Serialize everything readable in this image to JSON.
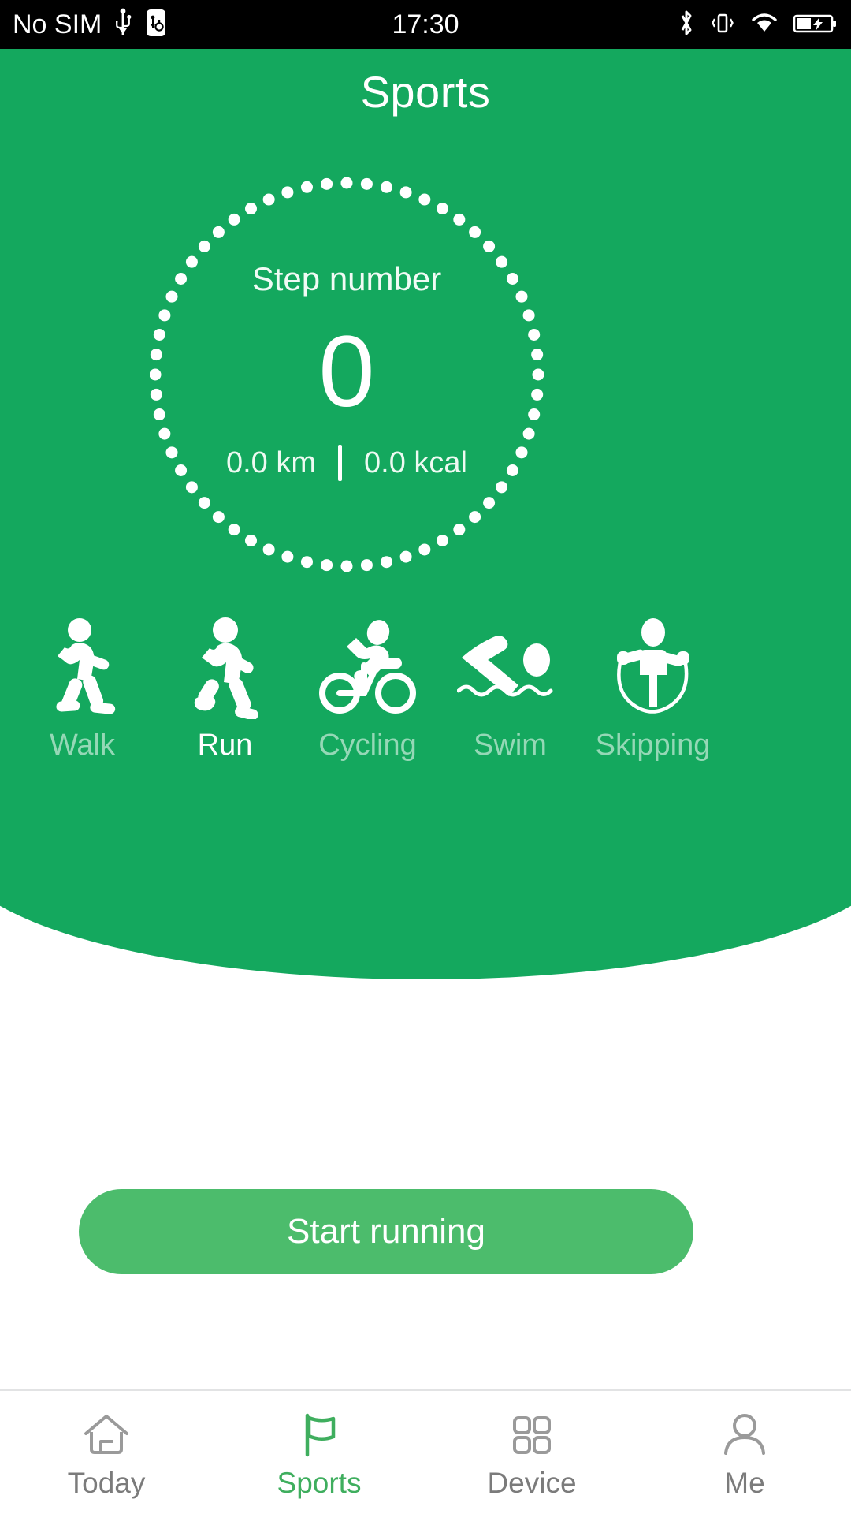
{
  "status_bar": {
    "carrier": "No SIM",
    "time": "17:30",
    "icons": [
      "usb-icon",
      "usb-debug-icon",
      "bluetooth-icon",
      "vibrate-icon",
      "wifi-icon",
      "battery-charging-icon"
    ]
  },
  "header": {
    "title": "Sports"
  },
  "step_ring": {
    "label": "Step number",
    "value": "0",
    "distance": "0.0 km",
    "calories": "0.0 kcal",
    "separator": "|",
    "dot_count": 60,
    "dot_color": "#ffffff"
  },
  "sports": {
    "selected": "Run",
    "items": [
      {
        "label": "Walk",
        "icon": "walk-icon",
        "active": false
      },
      {
        "label": "Run",
        "icon": "run-icon",
        "active": true
      },
      {
        "label": "Cycling",
        "icon": "cycling-icon",
        "active": false
      },
      {
        "label": "Swim",
        "icon": "swim-icon",
        "active": false
      },
      {
        "label": "Skipping",
        "icon": "skipping-icon",
        "active": false
      }
    ]
  },
  "action": {
    "start_label": "Start running"
  },
  "bottom_nav": {
    "items": [
      {
        "label": "Today",
        "icon": "home-icon",
        "active": false
      },
      {
        "label": "Sports",
        "icon": "flag-icon",
        "active": true
      },
      {
        "label": "Device",
        "icon": "grid-icon",
        "active": false
      },
      {
        "label": "Me",
        "icon": "person-icon",
        "active": false
      }
    ]
  },
  "colors": {
    "brand_green": "#14a85e",
    "button_green": "#4cbc6c",
    "nav_active_green": "#3fae5e",
    "nav_inactive_gray": "#7b7b7b",
    "map_bg": "#f8f9f9",
    "map_line": "#e9eaea"
  }
}
